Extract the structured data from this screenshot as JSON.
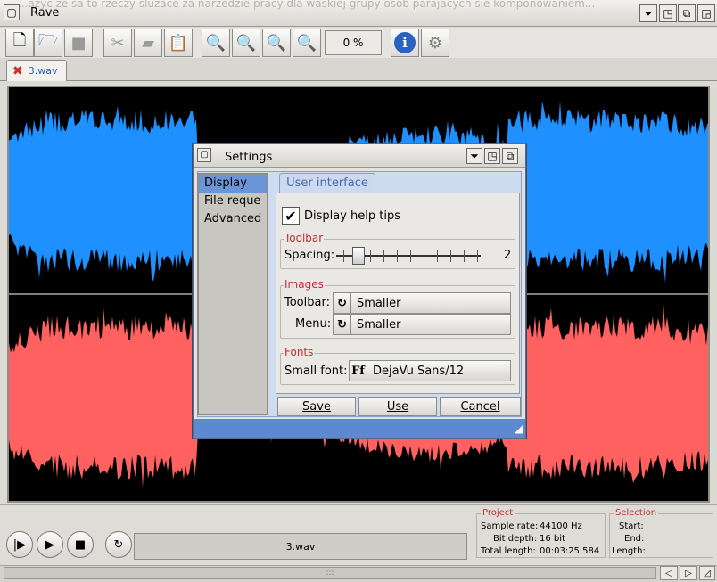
{
  "window": {
    "title": "Rave",
    "marquee": "...azyc ze sa to rzeczy sluzace za narzedzie pracy dla waskiej grupy osob parajacych sie komponowaniem..."
  },
  "toolbar": {
    "zoom": "0 %",
    "icons": [
      "new-icon",
      "open-icon",
      "save-icon",
      "cut-icon",
      "copy-icon",
      "paste-icon",
      "zoom-in-icon",
      "zoom-out-icon",
      "zoom-fit-icon",
      "zoom-selection-icon",
      "info-icon",
      "settings-icon"
    ]
  },
  "file_tab": {
    "label": "3.wav"
  },
  "waveform": {
    "channel1_color": "#1e90ff",
    "channel2_color": "#ff6060",
    "background": "#000000"
  },
  "transport": {
    "filename": "3.wav"
  },
  "project": {
    "title": "Project",
    "sample_rate_label": "Sample rate:",
    "sample_rate": "44100 Hz",
    "bit_depth_label": "Bit depth:",
    "bit_depth": "16 bit",
    "total_length_label": "Total length:",
    "total_length": "00:03:25.584"
  },
  "selection": {
    "title": "Selection",
    "start_label": "Start:",
    "end_label": "End:",
    "length_label": "Length:"
  },
  "scroll": {
    "grip": ":::"
  },
  "settings": {
    "title": "Settings",
    "categories": [
      "Display",
      "File reque",
      "Advanced"
    ],
    "selected_category": "Display",
    "tab": "User interface",
    "help_tips_label": "Display help tips",
    "help_tips_checked": true,
    "toolbar_group": "Toolbar",
    "spacing_label": "Spacing:",
    "spacing_value": "2",
    "spacing_fraction": 0.12,
    "images_group": "Images",
    "toolbar_images_label": "Toolbar:",
    "toolbar_images_value": "Smaller",
    "menu_images_label": "Menu:",
    "menu_images_value": "Smaller",
    "fonts_group": "Fonts",
    "small_font_label": "Small font:",
    "small_font_value": "DejaVu Sans/12",
    "font_icon": "Ff",
    "save": "Save",
    "use": "Use",
    "cancel": "Cancel"
  },
  "colors": {
    "accent": "#5b8ad0",
    "legend": "#c03030"
  }
}
